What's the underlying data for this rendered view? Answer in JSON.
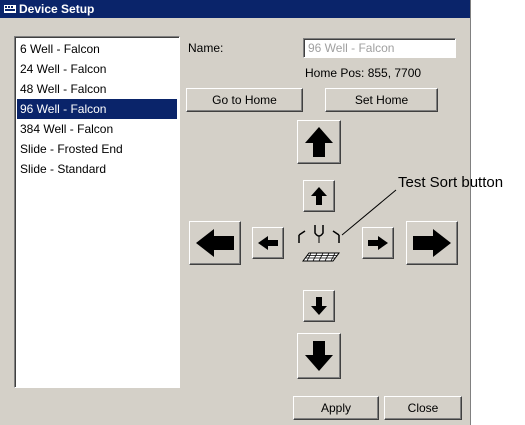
{
  "window": {
    "title": "Device Setup",
    "title_icon": "keyboard-icon"
  },
  "device_list": {
    "items": [
      {
        "label": "6 Well - Falcon",
        "selected": false
      },
      {
        "label": "24 Well - Falcon",
        "selected": false
      },
      {
        "label": "48 Well - Falcon",
        "selected": false
      },
      {
        "label": "96 Well - Falcon",
        "selected": true
      },
      {
        "label": "384 Well - Falcon",
        "selected": false
      },
      {
        "label": "Slide - Frosted End",
        "selected": false
      },
      {
        "label": "Slide - Standard",
        "selected": false
      }
    ]
  },
  "form": {
    "name_label": "Name:",
    "name_value": "96 Well - Falcon",
    "home_pos_text": "Home Pos: 855, 7700"
  },
  "buttons": {
    "go_to_home": "Go to Home",
    "set_home": "Set Home",
    "apply": "Apply",
    "close": "Close"
  },
  "movement_controls": {
    "up_large": "arrow-up-large-icon",
    "up_small": "arrow-up-small-icon",
    "left_large": "arrow-left-large-icon",
    "left_small": "arrow-left-small-icon",
    "right_small": "arrow-right-small-icon",
    "right_large": "arrow-right-large-icon",
    "down_small": "arrow-down-small-icon",
    "down_large": "arrow-down-large-icon",
    "center": "test-sort-icon"
  },
  "annotation": {
    "callout": "Test Sort button"
  },
  "colors": {
    "face": "#d4d0c8",
    "titlebar": "#0a246a",
    "selection": "#0a246a"
  }
}
